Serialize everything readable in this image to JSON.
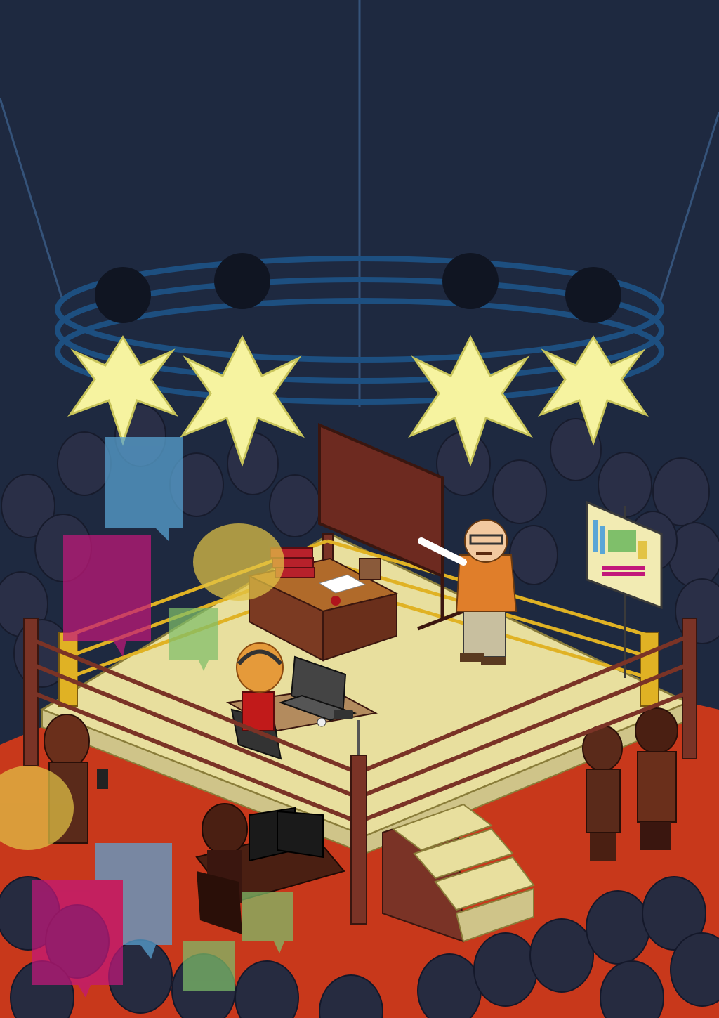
{
  "scene": {
    "description_free": true
  },
  "colors": {
    "sky": "#1e2940",
    "floor": "#c8381b",
    "ring_mat": "#e8df9e",
    "ring_side": "#cfc489",
    "rope_post": "#7a3326",
    "rope_gold": "#e0b224",
    "light_glow": "#f6f3a0",
    "light_ring": "#1d4f80",
    "chalkboard": "#6d2a20",
    "desk_wood": "#7b3a22",
    "crowd": "#2a2f47",
    "bubble_blue": "#5aa6d6",
    "bubble_magenta": "#c2187a",
    "bubble_green": "#7fbf6a",
    "bubble_yellow": "#e2c346"
  },
  "icons": [
    "spotlight-icon",
    "chat-bubble-icon",
    "periodic-table-poster-icon",
    "laptop-icon",
    "apple-icon",
    "book-stack-icon"
  ]
}
